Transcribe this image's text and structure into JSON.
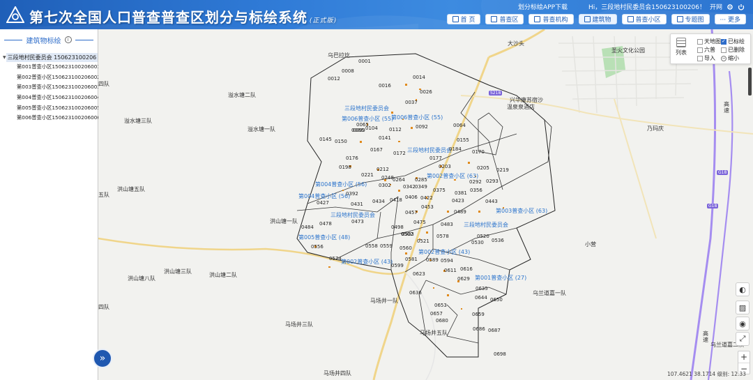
{
  "header": {
    "title": "第七次全国人口普查普查区划分与标绘系统",
    "subtitle": "(正式版)",
    "app_download": "划分标绘APP下载",
    "greeting": "Hi，三段地村民委员会150623100206！",
    "exit": "开网",
    "nav": [
      {
        "label": "首 页",
        "icon": "home-icon"
      },
      {
        "label": "普查区",
        "icon": "census-area-icon"
      },
      {
        "label": "普查机构",
        "icon": "agency-icon"
      },
      {
        "label": "建筑物",
        "icon": "building-icon"
      },
      {
        "label": "普查小区",
        "icon": "subdistrict-icon"
      },
      {
        "label": "专题图",
        "icon": "thematic-map-icon"
      },
      {
        "label": "··· 更多",
        "icon": "more-icon"
      }
    ],
    "colors": {
      "bar": "#2f7ad6",
      "accent": "#1f58b0"
    }
  },
  "sidebar": {
    "title": "建筑物标绘",
    "root": "三段地村民委员会 150623100206",
    "items": [
      "第001普查小区150623100206001",
      "第002普查小区150623100206002",
      "第003普查小区150623100206003",
      "第004普查小区150623100206004",
      "第005普查小区150623100206005",
      "第006普查小区150623100206006"
    ]
  },
  "layer_panel": {
    "list_label": "列表",
    "options": [
      {
        "label": "天地图",
        "checked": false
      },
      {
        "label": "已标绘",
        "checked": true
      },
      {
        "label": "六普",
        "checked": false
      },
      {
        "label": "已删除",
        "checked": false
      },
      {
        "label": "导入",
        "checked": false
      },
      {
        "label": "缩小",
        "checked": false
      }
    ]
  },
  "map": {
    "places": [
      "乌巴拉圪",
      "大沙头",
      "溢水塘二队",
      "溢水塘三队",
      "溢水塘一队",
      "兴华康苏宿沙",
      "温泉泉酒店",
      "乃玛庆",
      "洪山塘五队",
      "洪山塘一队",
      "洪山塘三队",
      "洪山塘八队",
      "洪山塘二队",
      "小营",
      "马场井一队",
      "马场井三队",
      "马场井五队",
      "马场井四队",
      "乌兰道嘉一队",
      "乌兰道嘉二队",
      "圣火文化公园",
      "四队",
      "四队",
      "五队",
      "高速",
      "高速"
    ],
    "areas": [
      "三段地村民委员会",
      "第006普查小区 (55)",
      "第006普查小区 (55)",
      "三段地村民委员会",
      "第004普查小区 (56)",
      "第004普查小区 (56)",
      "第002普查小区 (63)",
      "第003普查小区 (63)",
      "三段地村民委员会",
      "三段地村民委员会",
      "第005普查小区 (48)",
      "第002普查小区 (43)",
      "第002普查小区 (43)",
      "第001普查小区 (27)"
    ],
    "buildings": [
      "0001",
      "0008",
      "0012",
      "0014",
      "0016",
      "0026",
      "0037",
      "0065",
      "0086",
      "0099",
      "0104",
      "0112",
      "0092",
      "0064",
      "0145",
      "0150",
      "0141",
      "0167",
      "0172",
      "0155",
      "0170",
      "0176",
      "0184",
      "0177",
      "0198",
      "0212",
      "0203",
      "0205",
      "0219",
      "0221",
      "0248",
      "0264",
      "0285",
      "0302",
      "0342",
      "0349",
      "0375",
      "0381",
      "0292",
      "0293",
      "0356",
      "0392",
      "0427",
      "0431",
      "0434",
      "0418",
      "0406",
      "0422",
      "0423",
      "0443",
      "0453",
      "0457",
      "0489",
      "0473",
      "0478",
      "0484",
      "0475",
      "0483",
      "0498",
      "0503",
      "0521",
      "0578",
      "0520",
      "0530",
      "0536",
      "0556",
      "0558",
      "0559",
      "0560",
      "0574",
      "0581",
      "0589",
      "0594",
      "0599",
      "0611",
      "0616",
      "0623",
      "0629",
      "0635",
      "0636",
      "0644",
      "0650",
      "0653",
      "0657",
      "0659",
      "0680",
      "0686",
      "0687",
      "0698",
      "0502"
    ],
    "road_tags": [
      "G18",
      "G18",
      "S218"
    ],
    "status": "107.4621 38.1714 级别: 12.33"
  }
}
